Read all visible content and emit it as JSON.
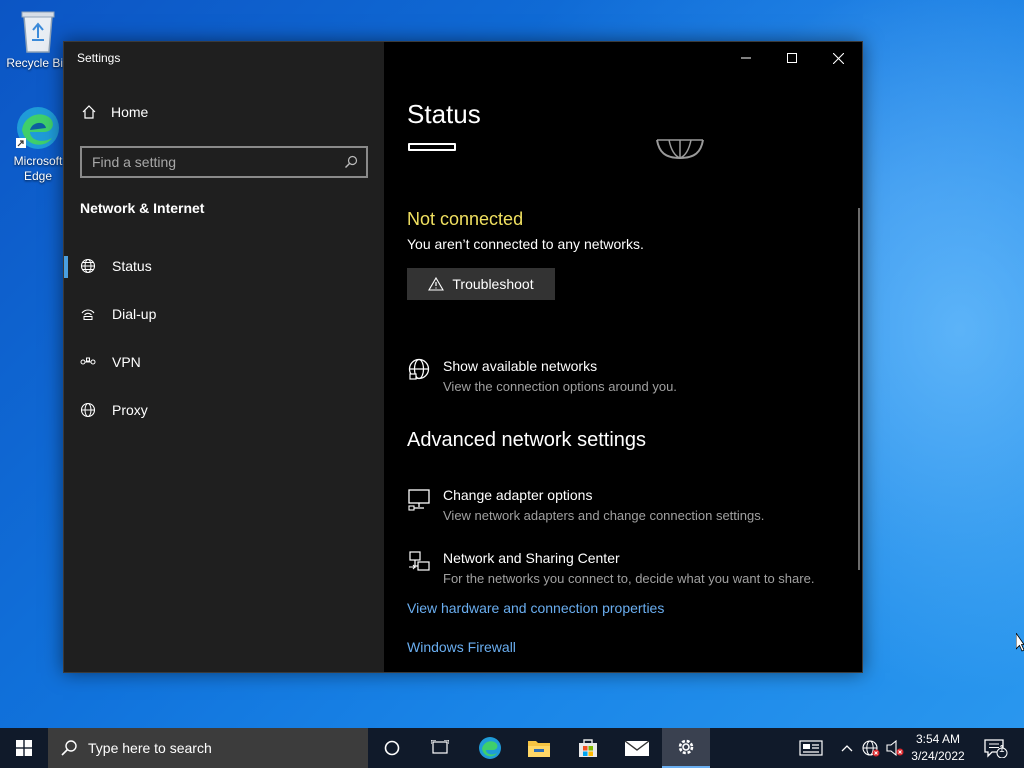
{
  "desktop": {
    "icons": [
      {
        "label": "Recycle Bin",
        "icon": "recycle-bin-icon"
      },
      {
        "label": "Microsoft Edge",
        "icon": "edge-icon"
      }
    ]
  },
  "window": {
    "title": "Settings",
    "controls": [
      "minimize-icon",
      "maximize-icon",
      "close-icon"
    ]
  },
  "sidebar": {
    "home_label": "Home",
    "search_placeholder": "Find a setting",
    "section_title": "Network & Internet",
    "items": [
      {
        "label": "Status",
        "icon": "globe-status-icon",
        "active": true
      },
      {
        "label": "Dial-up",
        "icon": "dialup-icon",
        "active": false
      },
      {
        "label": "VPN",
        "icon": "vpn-icon",
        "active": false
      },
      {
        "label": "Proxy",
        "icon": "globe-icon",
        "active": false
      }
    ]
  },
  "main": {
    "title": "Status",
    "status_heading": "Not connected",
    "status_desc": "You aren’t connected to any networks.",
    "troubleshoot_label": "Troubleshoot",
    "show_networks": {
      "title": "Show available networks",
      "desc": "View the connection options around you."
    },
    "advanced_heading": "Advanced network settings",
    "adapter_options": {
      "title": "Change adapter options",
      "desc": "View network adapters and change connection settings."
    },
    "sharing_center": {
      "title": "Network and Sharing Center",
      "desc": "For the networks you connect to, decide what you want to share."
    },
    "links": {
      "hardware": "View hardware and connection properties",
      "firewall": "Windows Firewall"
    }
  },
  "taskbar": {
    "search_placeholder": "Type here to search",
    "apps": [
      "cortana-icon",
      "task-view-icon",
      "edge-icon",
      "file-explorer-icon",
      "store-icon",
      "mail-icon",
      "settings-icon"
    ],
    "tray": {
      "time": "3:54 AM",
      "date": "3/24/2022",
      "notification_count": "1"
    }
  },
  "colors": {
    "accent": "#6aaef0",
    "status_yellow": "#f0e060",
    "sidebar_bg": "#1f1f1f",
    "main_bg": "#000000"
  }
}
